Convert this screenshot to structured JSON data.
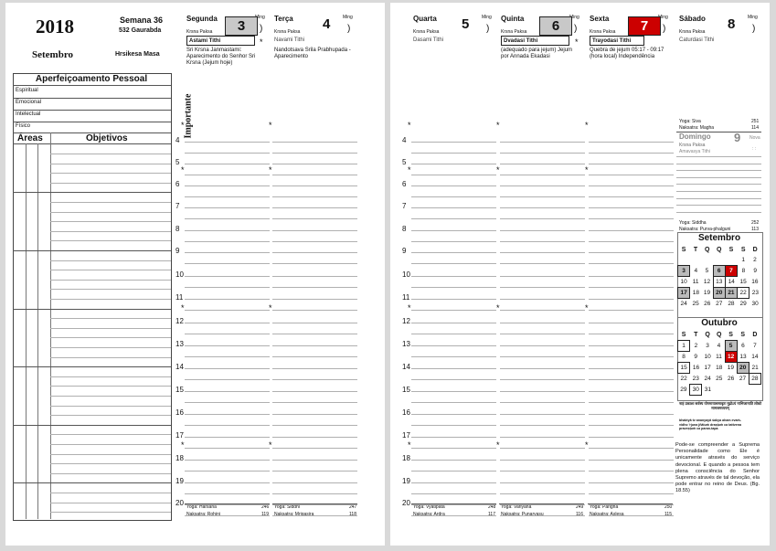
{
  "left": {
    "year": "2018",
    "week": "Semana 36",
    "gaurabda": "532 Gaurabda",
    "month": "Setembro",
    "masa": "Hrsikesa Masa",
    "personal_title": "Aperfeiçoamento Pessoal",
    "personal_rows": [
      "Espiritual",
      "Emocional",
      "Intelectual",
      "Físico"
    ],
    "areas_label": "Áreas",
    "objectives_label": "Objetivos",
    "important_label": "Importante",
    "hours": [
      "4",
      "5",
      "6",
      "7",
      "8",
      "9",
      "10",
      "11",
      "12",
      "13",
      "14",
      "15",
      "16",
      "17",
      "18",
      "19",
      "20"
    ]
  },
  "days": [
    {
      "name": "Segunda",
      "num": "3",
      "ming": "Ming",
      "paksa": "Krsna Paksa",
      "tithi": "Astami Tithi",
      "box": "gray",
      "notes": "Sri Krsna Janmastami: Aparecimento do Senhor Sri Krsna (Jejum hoje)",
      "yoga": "Yoga: Harsana",
      "yoga_n": "246",
      "nak": "Naksatra: Rohini",
      "nak_n": "119"
    },
    {
      "name": "Terça",
      "num": "4",
      "ming": "Ming",
      "paksa": "Krsna Paksa",
      "tithi": "Navami Tithi",
      "box": "none",
      "notes": "Nandotsava Srila Prabhupada - Aparecimento",
      "yoga": "Yoga: Siddhi",
      "yoga_n": "247",
      "nak": "Naksatra: Mrigasira",
      "nak_n": "118"
    },
    {
      "name": "Quarta",
      "num": "5",
      "ming": "Ming",
      "paksa": "Krsna Paksa",
      "tithi": "Dasami Tithi",
      "box": "none",
      "notes": "",
      "yoga": "Yoga: Vyatipata",
      "yoga_n": "248",
      "nak": "Naksatra: Ardra",
      "nak_n": "117"
    },
    {
      "name": "Quinta",
      "num": "6",
      "ming": "Ming",
      "paksa": "Krsna Paksa",
      "tithi": "Dvadasi Tithi",
      "box": "gray",
      "notes": "(adequado para jejum) Jejum por Annada Ekadasi",
      "yoga": "Yoga: Variyana",
      "yoga_n": "249",
      "nak": "Naksatra: Punarvasu",
      "nak_n": "116"
    },
    {
      "name": "Sexta",
      "num": "7",
      "ming": "Ming",
      "paksa": "Krsna Paksa",
      "tithi": "Trayodasi Tithi",
      "box": "red",
      "notes": "Quebra de jejum 05:17 - 09:17 (hora local) Independência",
      "yoga": "Yoga: Parigha",
      "yoga_n": "250",
      "nak": "Naksatra: Aslesa",
      "nak_n": "115"
    },
    {
      "name": "Sábado",
      "num": "8",
      "ming": "Ming",
      "paksa": "Krsna Paksa",
      "tithi": "Caturdasi Tithi",
      "box": "none",
      "notes": ""
    }
  ],
  "saturday_info": {
    "yoga": "Yoga: Siva",
    "yoga_n": "251",
    "nak": "Naksatra: Magha",
    "nak_n": "114"
  },
  "sunday": {
    "name": "Domingo",
    "num": "9",
    "moon": "Nova",
    "paksa": "Krsna Paksa",
    "tithi": "Amavasya Tithi",
    "yoga": "Yoga: Siddha",
    "yoga_n": "252",
    "nak": "Naksatra: Purva-phalguni",
    "nak_n": "113"
  },
  "cal_sep": {
    "title": "Setembro",
    "head": [
      "S",
      "T",
      "Q",
      "Q",
      "S",
      "S",
      "D"
    ],
    "rows": [
      [
        "",
        "",
        "",
        "",
        "",
        "1",
        "2"
      ],
      [
        "3",
        "4",
        "5",
        "6",
        "7",
        "8",
        "9"
      ],
      [
        "10",
        "11",
        "12",
        "13",
        "14",
        "15",
        "16"
      ],
      [
        "17",
        "18",
        "19",
        "20",
        "21",
        "22",
        "23"
      ],
      [
        "24",
        "25",
        "26",
        "27",
        "28",
        "29",
        "30"
      ]
    ]
  },
  "cal_oct": {
    "title": "Outubro",
    "head": [
      "S",
      "T",
      "Q",
      "Q",
      "S",
      "S",
      "D"
    ],
    "rows": [
      [
        "1",
        "2",
        "3",
        "4",
        "5",
        "6",
        "7"
      ],
      [
        "8",
        "9",
        "10",
        "11",
        "12",
        "13",
        "14"
      ],
      [
        "15",
        "16",
        "17",
        "18",
        "19",
        "20",
        "21"
      ],
      [
        "22",
        "23",
        "24",
        "25",
        "26",
        "27",
        "28"
      ],
      [
        "29",
        "30",
        "31",
        "",
        "",
        "",
        ""
      ]
    ]
  },
  "verse_devanagari": "नाहं प्रकाशः सर्वस्य योगमायासमावृतः मूढोऽयं नाभिजानाति लोको मामजमव्ययम्",
  "verse_translit": "bhaktyā tv ananyayā śakya aham evaṁ-vidho 'rjuna jñātuṁ draṣṭuṁ ca tattvena praveṣṭuṁ ca paran-tapa",
  "quote": "Pode-se compreender a Suprema Personalidade como Ele é unicamente através do serviço devocional. E quando a pessoa tem plena consciência do Senhor Supremo através de tal devoção, ela pode entrar no reino de Deus. (Bg. 18.55)"
}
